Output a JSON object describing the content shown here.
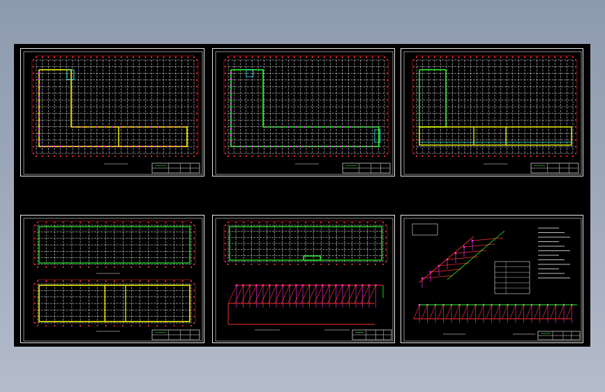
{
  "viewer": {
    "background": "#000000",
    "sheet_count": 6
  },
  "sheets": [
    {
      "id": "sheet-1",
      "kind": "floor-plan-with-grid"
    },
    {
      "id": "sheet-2",
      "kind": "floor-plan-with-grid"
    },
    {
      "id": "sheet-3",
      "kind": "floor-plan-with-grid"
    },
    {
      "id": "sheet-4",
      "kind": "two-plans"
    },
    {
      "id": "sheet-5",
      "kind": "plan-and-isometric"
    },
    {
      "id": "sheet-6",
      "kind": "isometrics-and-notes"
    }
  ],
  "colors": {
    "grid": "#ffffff",
    "axis": "#ff3030",
    "dim": "#2aff2a",
    "wall": "#ffff00",
    "pipe": "#ff30ff",
    "cyan": "#30ffff",
    "frame": "#e8e8e8"
  }
}
